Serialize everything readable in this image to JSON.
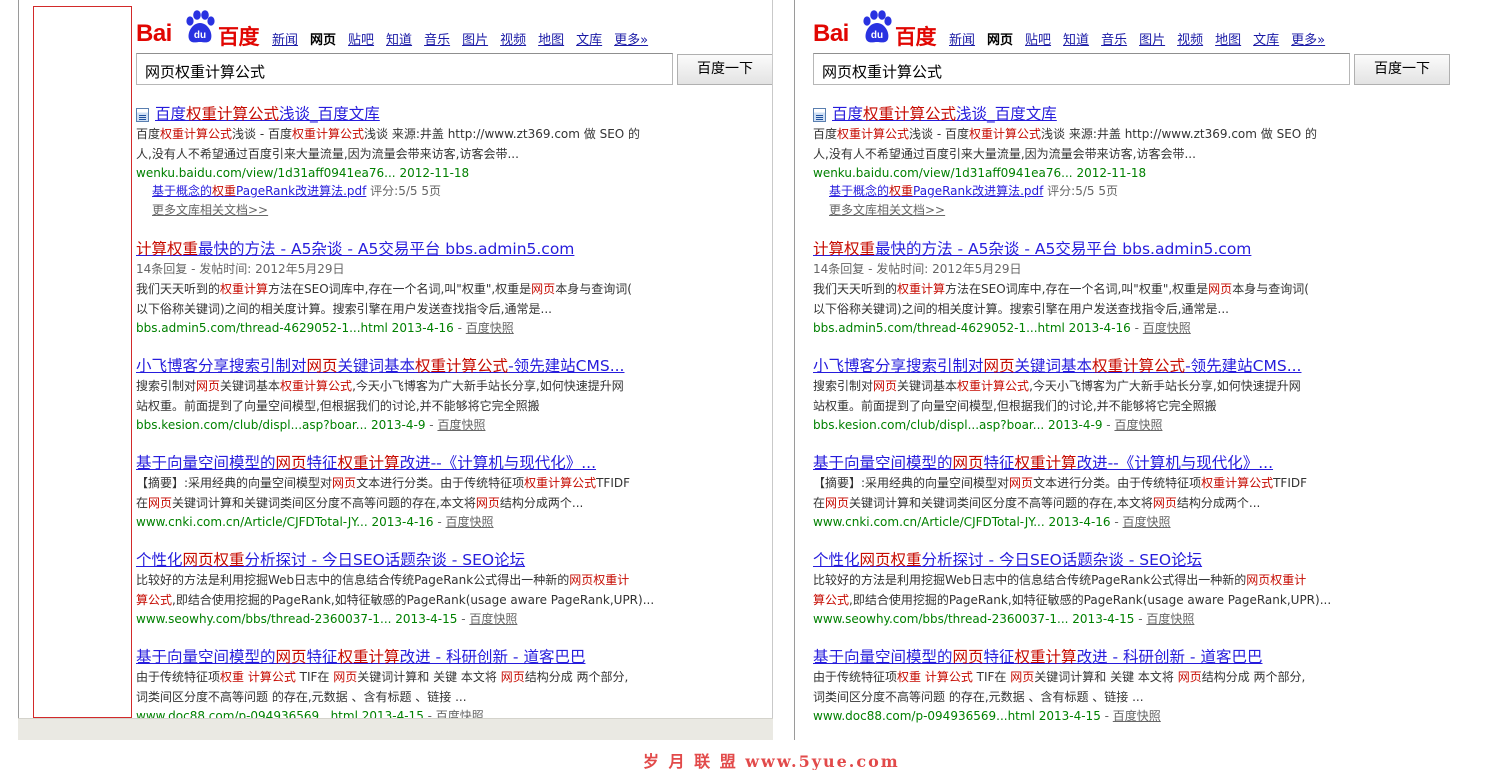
{
  "logo": {
    "text_left": "Bai",
    "paw_text": "du",
    "text_right": "百度"
  },
  "nav": [
    "新闻",
    "网页",
    "贴吧",
    "知道",
    "音乐",
    "图片",
    "视频",
    "地图",
    "文库",
    "更多»"
  ],
  "nav_active_index": 1,
  "search": {
    "query": "网页权重计算公式",
    "button": "百度一下"
  },
  "results": [
    {
      "icon": "document-icon",
      "title": [
        {
          "t": "百度"
        },
        {
          "t": "权重计算公式",
          "hl": true
        },
        {
          "t": "浅谈_百度文库"
        }
      ],
      "desc": [
        [
          {
            "t": "百度"
          },
          {
            "t": "权重计算公式",
            "hl": true
          },
          {
            "t": "浅谈 - 百度"
          },
          {
            "t": "权重计算公式",
            "hl": true
          },
          {
            "t": "浅谈 来源:井盖 http://www.zt369.com 做 SEO 的"
          }
        ],
        [
          {
            "t": "人,没有人不希望通过百度引来大量流量,因为流量会带来访客,访客会带..."
          }
        ]
      ],
      "url": "wenku.baidu.com/view/1d31aff0941ea76... 2012-11-18",
      "sublinks": {
        "link": [
          {
            "t": "基于概念的"
          },
          {
            "t": "权重",
            "hl": true
          },
          {
            "t": "PageRank改进算法.pdf"
          }
        ],
        "rating": "评分:5/5 5页",
        "more": "更多文库相关文档>>"
      }
    },
    {
      "title": [
        {
          "t": "计算权重",
          "hl": true
        },
        {
          "t": "最快的方法 - A5杂谈 - A5交易平台 bbs.admin5.com"
        }
      ],
      "meta": "14条回复 - 发帖时间: 2012年5月29日",
      "desc": [
        [
          {
            "t": "我们天天听到的"
          },
          {
            "t": "权重计算",
            "hl": true
          },
          {
            "t": "方法在SEO词库中,存在一个名词,叫\"权重\",权重是"
          },
          {
            "t": "网页",
            "hl": true
          },
          {
            "t": "本身与查询词("
          }
        ],
        [
          {
            "t": "以下俗称关键词)之间的相关度计算。搜索引擎在用户发送查找指令后,通常是..."
          }
        ]
      ],
      "url": "bbs.admin5.com/thread-4629052-1...html 2013-4-16",
      "snapshot": "百度快照"
    },
    {
      "title": [
        {
          "t": "小飞博客分享搜索引制对"
        },
        {
          "t": "网页",
          "hl": true
        },
        {
          "t": "关键词基本"
        },
        {
          "t": "权重计算公式",
          "hl": true
        },
        {
          "t": "-领先建站CMS..."
        }
      ],
      "desc": [
        [
          {
            "t": "搜索引制对"
          },
          {
            "t": "网页",
            "hl": true
          },
          {
            "t": "关键词基本"
          },
          {
            "t": "权重计算公式",
            "hl": true
          },
          {
            "t": ",今天小飞博客为广大新手站长分享,如何快速提升网"
          }
        ],
        [
          {
            "t": "站权重。前面提到了向量空间模型,但根据我们的讨论,并不能够将它完全照搬"
          }
        ]
      ],
      "url": "bbs.kesion.com/club/displ...asp?boar... 2013-4-9",
      "snapshot": "百度快照"
    },
    {
      "title": [
        {
          "t": "基于向量空间模型的"
        },
        {
          "t": "网页",
          "hl": true
        },
        {
          "t": "特征"
        },
        {
          "t": "权重计算",
          "hl": true
        },
        {
          "t": "改进--《计算机与现代化》..."
        }
      ],
      "desc": [
        [
          {
            "t": "【摘要】:采用经典的向量空间模型对"
          },
          {
            "t": "网页",
            "hl": true
          },
          {
            "t": "文本进行分类。由于传统特征项"
          },
          {
            "t": "权重计算公式",
            "hl": true
          },
          {
            "t": "TFIDF"
          }
        ],
        [
          {
            "t": "在"
          },
          {
            "t": "网页",
            "hl": true
          },
          {
            "t": "关键词计算和关键词类间区分度不高等问题的存在,本文将"
          },
          {
            "t": "网页",
            "hl": true
          },
          {
            "t": "结构分成两个..."
          }
        ]
      ],
      "url": "www.cnki.com.cn/Article/CJFDTotal-JY... 2013-4-16",
      "snapshot": "百度快照"
    },
    {
      "title": [
        {
          "t": "个性化"
        },
        {
          "t": "网页权重",
          "hl": true
        },
        {
          "t": "分析探讨 - 今日SEO话题杂谈 - SEO论坛"
        }
      ],
      "desc": [
        [
          {
            "t": "比较好的方法是利用挖掘Web日志中的信息结合传统PageRank公式得出一种新的"
          },
          {
            "t": "网页权重计",
            "hl": true
          }
        ],
        [
          {
            "t": "算公式",
            "hl": true
          },
          {
            "t": ",即结合使用挖掘的PageRank,如特征敏感的PageRank(usage aware PageRank,UPR)..."
          }
        ]
      ],
      "url": "www.seowhy.com/bbs/thread-2360037-1... 2013-4-15",
      "snapshot": "百度快照"
    },
    {
      "title": [
        {
          "t": "基于向量空间模型的"
        },
        {
          "t": "网页",
          "hl": true
        },
        {
          "t": "特征"
        },
        {
          "t": "权重计算",
          "hl": true
        },
        {
          "t": "改进 - 科研创新 - 道客巴巴"
        }
      ],
      "desc": [
        [
          {
            "t": "由于传统特征项"
          },
          {
            "t": "权重 计算公式",
            "hl": true
          },
          {
            "t": " TIF在 "
          },
          {
            "t": "网页",
            "hl": true
          },
          {
            "t": "关键词计算和 关键 本文将 "
          },
          {
            "t": "网页",
            "hl": true
          },
          {
            "t": "结构分成 两个部分,"
          }
        ],
        [
          {
            "t": "词类间区分度不高等问题 的存在,元数据 、含有标题 、链接 ..."
          }
        ]
      ],
      "url": "www.doc88.com/p-094936569...html 2013-4-15",
      "snapshot": "百度快照"
    }
  ],
  "watermark": "岁 月 联 盟  www.5yue.com",
  "colors": {
    "link": "#261cdc",
    "highlight": "#c60a00",
    "url": "#008000",
    "brand": "#e10602",
    "frame": "#d22a2a"
  }
}
